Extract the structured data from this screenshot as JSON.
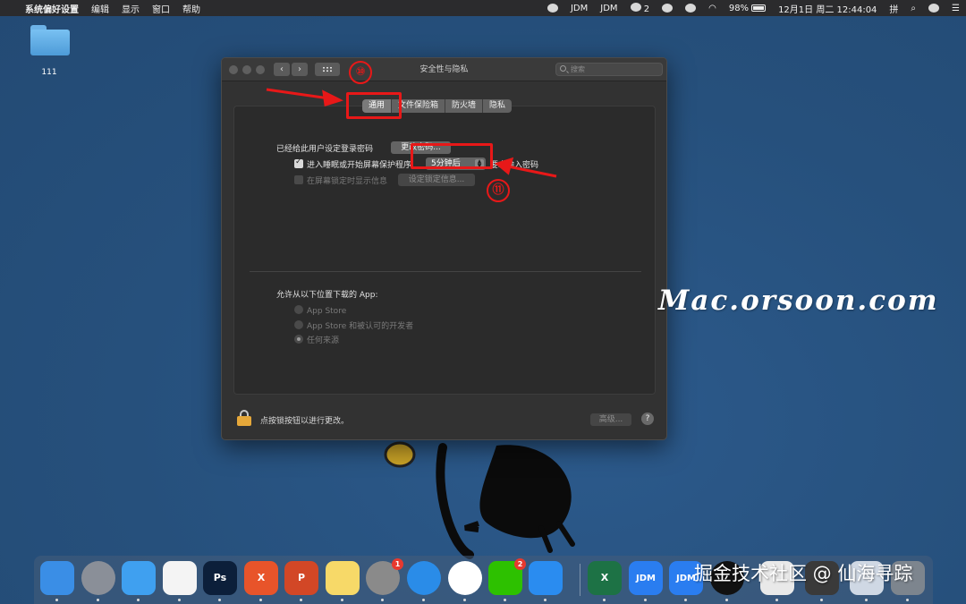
{
  "menubar": {
    "app_name": "系统偏好设置",
    "menus": [
      "编辑",
      "显示",
      "窗口",
      "帮助"
    ],
    "status_items": [
      "JDM",
      "JDM",
      "2",
      "98%",
      "12月1日 周二 12:44:04",
      "拼"
    ],
    "battery_level_percent": 98
  },
  "desktop": {
    "folder_label": "111"
  },
  "window": {
    "title": "安全性与隐私",
    "search_placeholder": "搜索",
    "tabs": [
      "通用",
      "文件保险箱",
      "防火墙",
      "隐私"
    ],
    "active_tab": "通用",
    "password_set_label": "已经给此用户设定登录密码",
    "change_password_button": "更改密码...",
    "require_password_label_before": "进入睡眠或开始屏幕保护程序",
    "require_password_value": "5分钟后",
    "require_password_label_after": "要求输入密码",
    "show_message_label": "在屏幕锁定时显示信息",
    "set_lock_message_button": "设定锁定信息...",
    "allow_apps_label": "允许从以下位置下载的 App:",
    "allow_apps_options": [
      "App Store",
      "App Store 和被认可的开发者",
      "任何来源"
    ],
    "allow_apps_selected": "任何来源",
    "lock_text": "点按锁按钮以进行更改。",
    "advanced_button": "高级...",
    "help_button": "?"
  },
  "annotations": {
    "step_10": "⑩",
    "step_11": "⑪"
  },
  "watermarks": {
    "main": "Mac.orsoon.com",
    "bottom": "掘金技术社区 @ 仙海寻踪"
  },
  "dock": {
    "apps": [
      {
        "icon": "finder-icon",
        "label": "",
        "color": "#3a8ee6"
      },
      {
        "icon": "launchpad-icon",
        "label": "",
        "color": "#8a8f98"
      },
      {
        "icon": "messages-icon",
        "label": "",
        "color": "#3fa0f0"
      },
      {
        "icon": "reminders-icon",
        "label": "",
        "color": "#f4f4f4"
      },
      {
        "icon": "photoshop-icon",
        "label": "Ps",
        "color": "#0c1f3a"
      },
      {
        "icon": "xmind-icon",
        "label": "X",
        "color": "#e8542a"
      },
      {
        "icon": "powerpoint-icon",
        "label": "P",
        "color": "#d24726"
      },
      {
        "icon": "notes-icon",
        "label": "",
        "color": "#f7d968"
      },
      {
        "icon": "system-preferences-icon",
        "label": "",
        "color": "#8a8a8a",
        "badge": "1"
      },
      {
        "icon": "safari-icon",
        "label": "",
        "color": "#2a8ce8"
      },
      {
        "icon": "chrome-icon",
        "label": "",
        "color": "#ffffff"
      },
      {
        "icon": "wechat-icon",
        "label": "",
        "color": "#2dc100",
        "badge": "2"
      },
      {
        "icon": "dingtalk-icon",
        "label": "",
        "color": "#2a8cf0"
      },
      {
        "icon": "excel-icon",
        "label": "X",
        "color": "#1d7245"
      },
      {
        "icon": "jdm-icon",
        "label": "JDM",
        "color": "#2a7df0"
      },
      {
        "icon": "jdm-icon",
        "label": "JDM",
        "color": "#2a7df0"
      },
      {
        "icon": "qq-icon",
        "label": "",
        "color": "#111111"
      },
      {
        "icon": "mail-icon",
        "label": "",
        "color": "#e9e9e9"
      },
      {
        "icon": "preview-icon",
        "label": "",
        "color": "#3a3a3a"
      },
      {
        "icon": "downloads-icon",
        "label": "",
        "color": "#cfd8e4"
      },
      {
        "icon": "trash-icon",
        "label": "",
        "color": "#7d858e"
      }
    ]
  }
}
